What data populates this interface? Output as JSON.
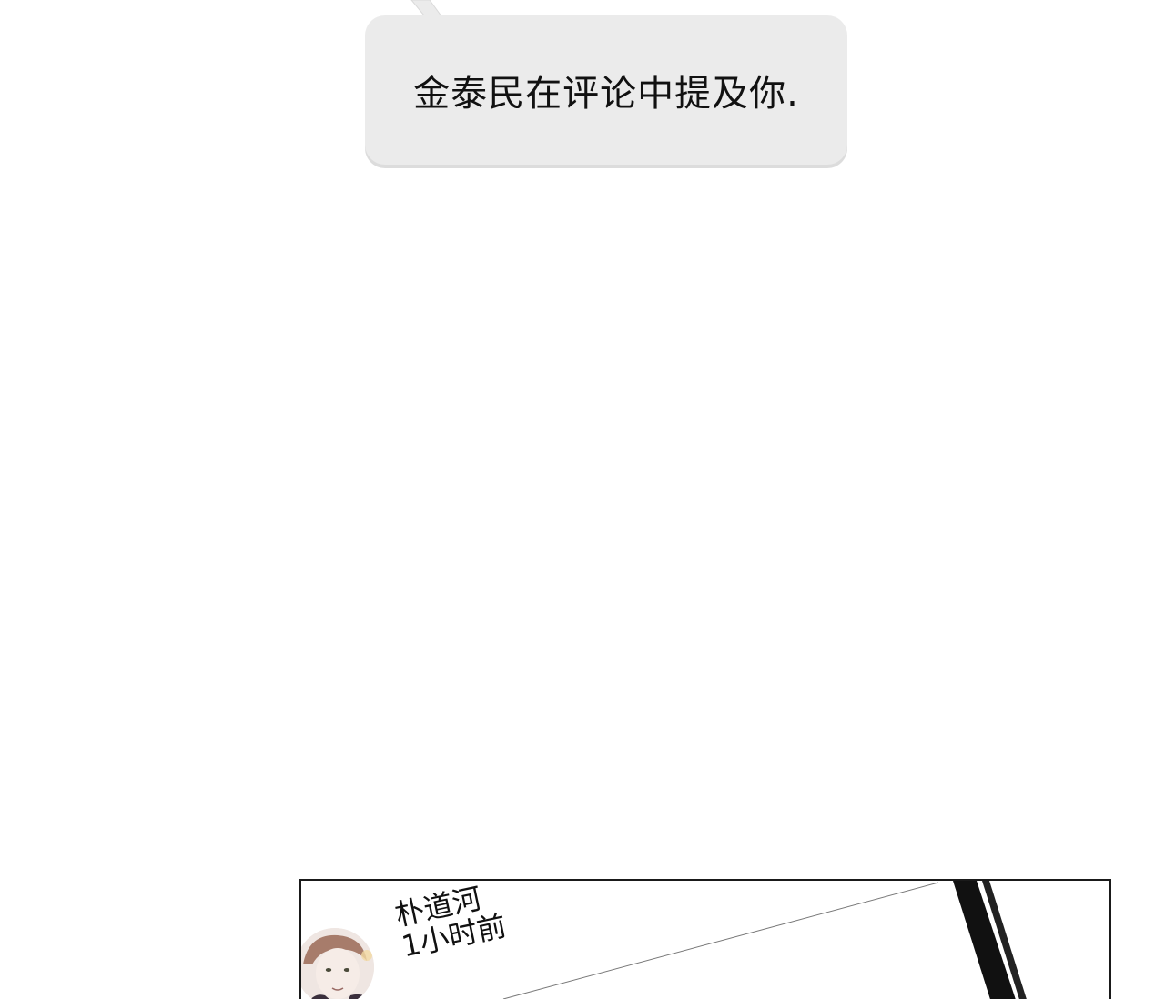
{
  "notification": {
    "text": "金泰民在评论中提及你."
  },
  "comment_panel": {
    "author": "朴道河",
    "time": "1小时前",
    "avatar_icon": "user-avatar-icon"
  },
  "colors": {
    "bubble_fill": "#ebebeb",
    "panel_border": "#1a1a1a",
    "text": "#111111"
  }
}
